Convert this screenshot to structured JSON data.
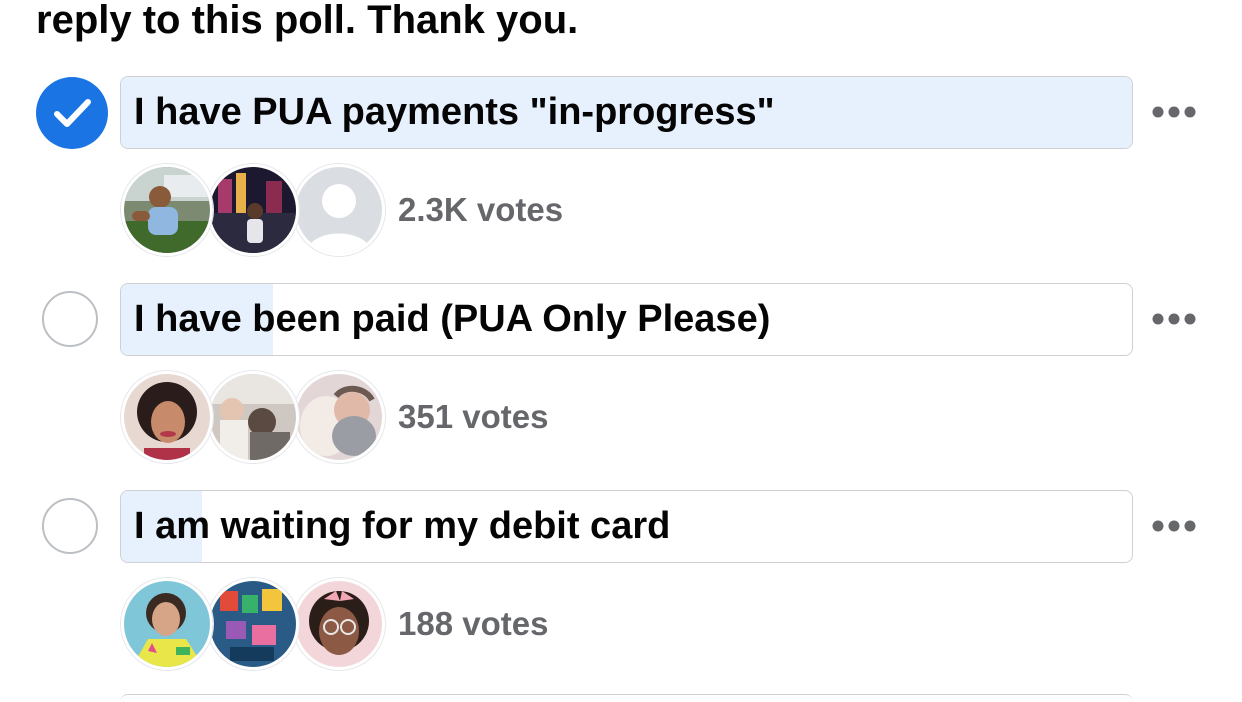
{
  "poll": {
    "intro_text": "reply to this poll. Thank you.",
    "options": [
      {
        "label": "I have PUA payments \"in-progress\"",
        "votes": "2.3K votes",
        "selected": true,
        "share": 1.0
      },
      {
        "label": "I have been paid (PUA Only Please)",
        "votes": "351 votes",
        "selected": false,
        "share": 0.15
      },
      {
        "label": "I am waiting for my debit card",
        "votes": "188 votes",
        "selected": false,
        "share": 0.08
      }
    ]
  },
  "icons": {
    "checked": "check-icon",
    "more": "more-horizontal-icon",
    "default_avatar": "default-person-avatar-icon"
  },
  "colors": {
    "accent": "#1b74e4",
    "bar_fill": "#e7f0fd",
    "muted_text": "#65676b",
    "border": "#ced0d4"
  }
}
